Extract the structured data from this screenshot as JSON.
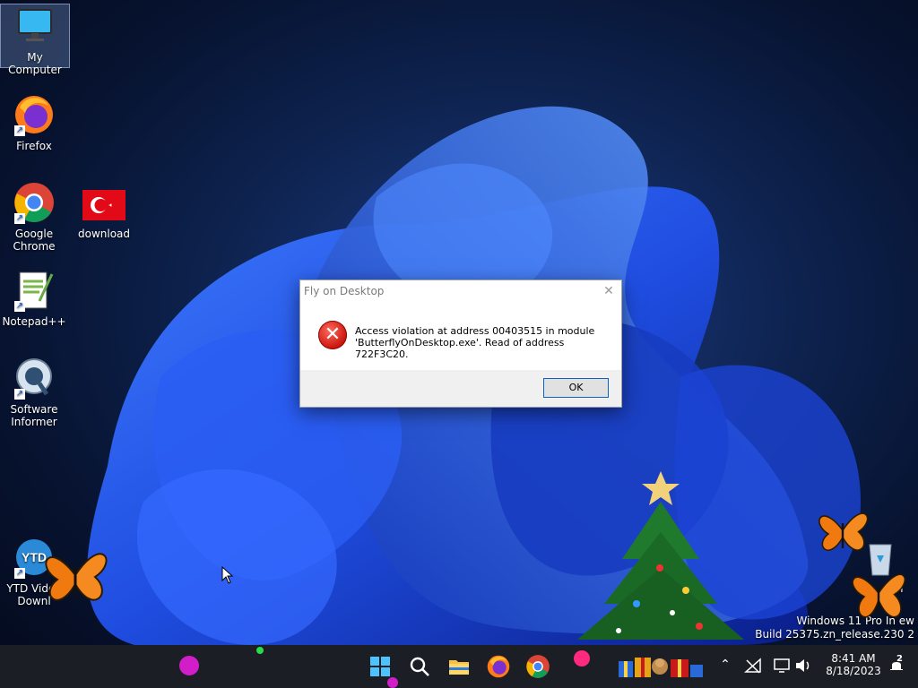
{
  "desktop": {
    "icons": [
      {
        "label": "My Computer"
      },
      {
        "label": "Firefox"
      },
      {
        "label": "Google Chrome"
      },
      {
        "label": "download"
      },
      {
        "label": "Notepad++"
      },
      {
        "label": "Software Informer"
      },
      {
        "label": "YTD Video Downl"
      },
      {
        "label": "Recycle Bin",
        "visible_text": "in"
      }
    ],
    "watermark": {
      "line1": "Windows 11 Pro In",
      "line1_tail": "ew",
      "line2": "Build 25375.zn_release.230",
      "line2_tail": "2"
    }
  },
  "dialog": {
    "title": "Fly on Desktop",
    "close_label": "✕",
    "message": "Access violation at address 00403515 in module 'ButterflyOnDesktop.exe'. Read of address 722F3C20.",
    "ok_label": "OK"
  },
  "taskbar": {
    "apps": [
      "start-button",
      "search-button",
      "file-explorer",
      "firefox",
      "chrome",
      "gifts"
    ],
    "time": "8:41 AM",
    "date": "8/18/2023",
    "notification_count": "2"
  },
  "colors": {
    "accent": "#0a64c8",
    "taskbar": "#1b1e24",
    "error": "#c9140c"
  }
}
